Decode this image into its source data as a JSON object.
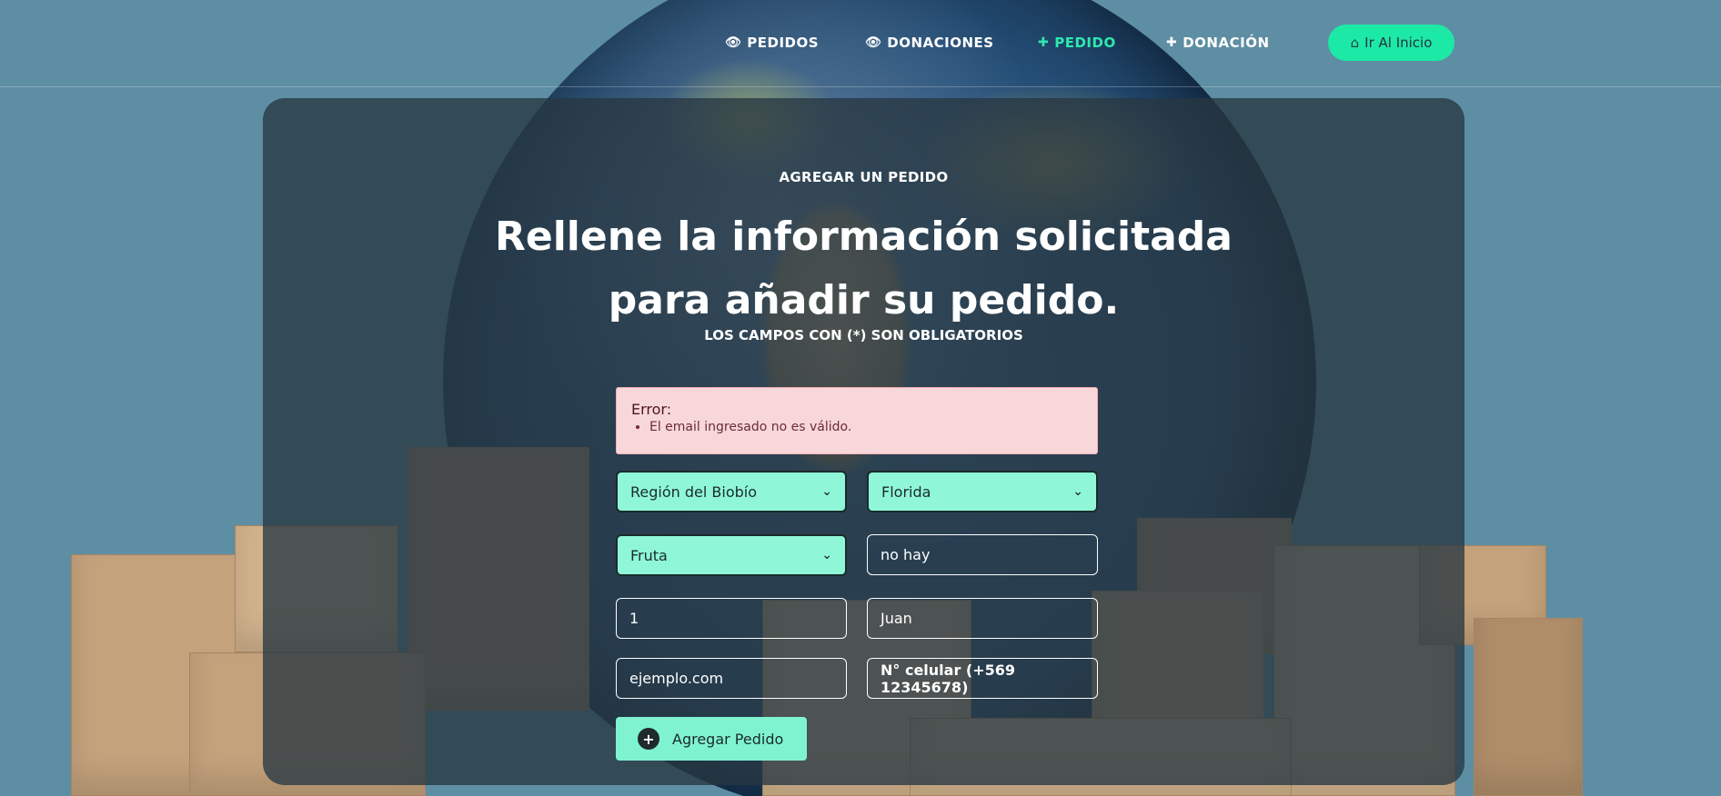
{
  "nav": {
    "items": [
      {
        "icon": "eye-icon",
        "glyph": "👁",
        "label": "PEDIDOS"
      },
      {
        "icon": "eye-icon",
        "glyph": "👁",
        "label": "DONACIONES"
      },
      {
        "icon": "plus-icon",
        "glyph": "✚",
        "label": "PEDIDO"
      },
      {
        "icon": "plus-icon",
        "glyph": "✚",
        "label": "DONACIÓN"
      }
    ],
    "home_button": {
      "icon": "home-icon",
      "glyph": "⌂",
      "label": "Ir Al Inicio"
    }
  },
  "form": {
    "kicker": "AGREGAR UN PEDIDO",
    "heading_line1": "Rellene la información solicitada",
    "heading_line2": "para añadir su pedido.",
    "required_note": "LOS CAMPOS CON (*) SON OBLIGATORIOS",
    "error": {
      "title": "Error:",
      "messages": [
        "El email ingresado no es válido."
      ]
    },
    "region_select": "Región del Biobío",
    "comuna_select": "Florida",
    "tipo_select": "Fruta",
    "descripcion_value": "no hay",
    "cantidad_value": "1",
    "nombre_value": "Juan",
    "email_value": "ejemplo.com",
    "celular_placeholder": "N° celular (+569 12345678)",
    "submit_label": "Agregar Pedido"
  },
  "colors": {
    "accent": "#1de9a6",
    "select_bg": "#8ff7d8",
    "page_bg": "#5e8ea3",
    "error_bg": "#f8d7da"
  }
}
